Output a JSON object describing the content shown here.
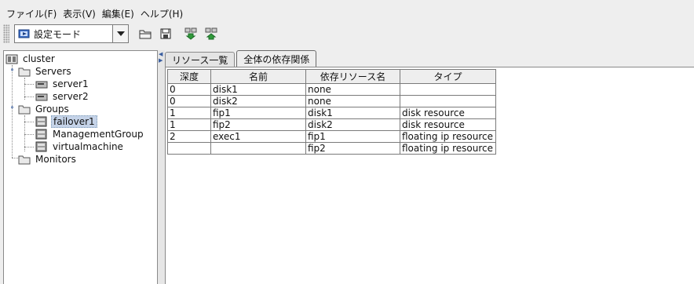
{
  "menu": [
    "ファイル(F)",
    "表示(V)",
    "編集(E)",
    "ヘルプ(H)"
  ],
  "toolbar": {
    "mode_label": "設定モード",
    "buttons": [
      "open-folder-icon",
      "save-icon",
      "download-icon",
      "upload-icon"
    ]
  },
  "tree": {
    "root": "cluster",
    "servers": "Servers",
    "server1": "server1",
    "server2": "server2",
    "groups": "Groups",
    "failover1": "failover1",
    "management_group": "ManagementGroup",
    "virtualmachine": "virtualmachine",
    "monitors": "Monitors"
  },
  "tabs": [
    "リソース一覧",
    "全体の依存関係"
  ],
  "table": {
    "headers": [
      "深度",
      "名前",
      "依存リソース名",
      "タイプ"
    ],
    "rows": [
      [
        "0",
        "disk1",
        "none",
        ""
      ],
      [
        "0",
        "disk2",
        "none",
        ""
      ],
      [
        "1",
        "fip1",
        "disk1",
        "disk resource"
      ],
      [
        "1",
        "fip2",
        "disk2",
        "disk resource"
      ],
      [
        "2",
        "exec1",
        "fip1",
        "floating ip resource"
      ],
      [
        "",
        "",
        "fip2",
        "floating ip resource"
      ]
    ]
  },
  "colors": {
    "selection": "#c5d3e8",
    "accent": "#2e5aa8"
  }
}
